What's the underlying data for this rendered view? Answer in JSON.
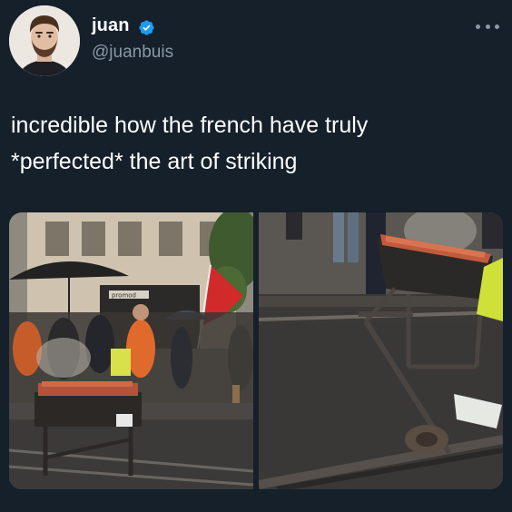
{
  "tweet": {
    "display_name": "juan",
    "handle": "@juanbuis",
    "verified_icon": "verified-badge-icon",
    "more_icon": "more-options-icon",
    "text_lines": [
      "incredible how the french have truly",
      "*perfected* the art of striking"
    ]
  },
  "media": {
    "left_sign_text": "promod"
  },
  "colors": {
    "background": "#15202b",
    "text_primary": "#ffffff",
    "text_secondary": "#8b98a5",
    "verified_blue": "#1d9bf0"
  }
}
